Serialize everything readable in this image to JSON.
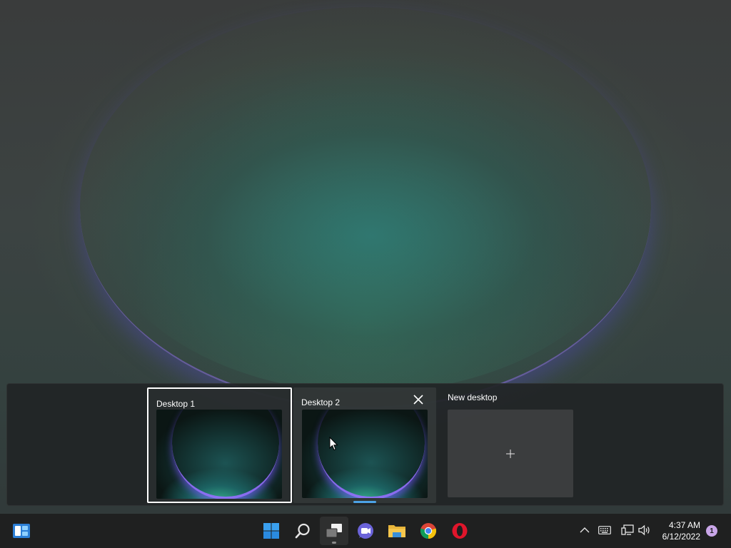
{
  "task_view": {
    "desktops": [
      {
        "label": "Desktop 1",
        "selected": true
      },
      {
        "label": "Desktop 2",
        "selected": false
      }
    ],
    "new_desktop_label": "New desktop"
  },
  "taskbar": {
    "apps": [
      {
        "name": "widgets-icon"
      },
      {
        "name": "start-icon"
      },
      {
        "name": "search-icon"
      },
      {
        "name": "task-view-icon",
        "active": true
      },
      {
        "name": "teams-chat-icon"
      },
      {
        "name": "file-explorer-icon"
      },
      {
        "name": "chrome-icon"
      },
      {
        "name": "opera-icon"
      }
    ],
    "clock": {
      "time": "4:37 AM",
      "date": "6/12/2022"
    },
    "notification_count": "1"
  },
  "colors": {
    "accent": "#4da3e6",
    "taskbar_bg": "#1f2020",
    "notification_badge": "#c9a6e8"
  }
}
